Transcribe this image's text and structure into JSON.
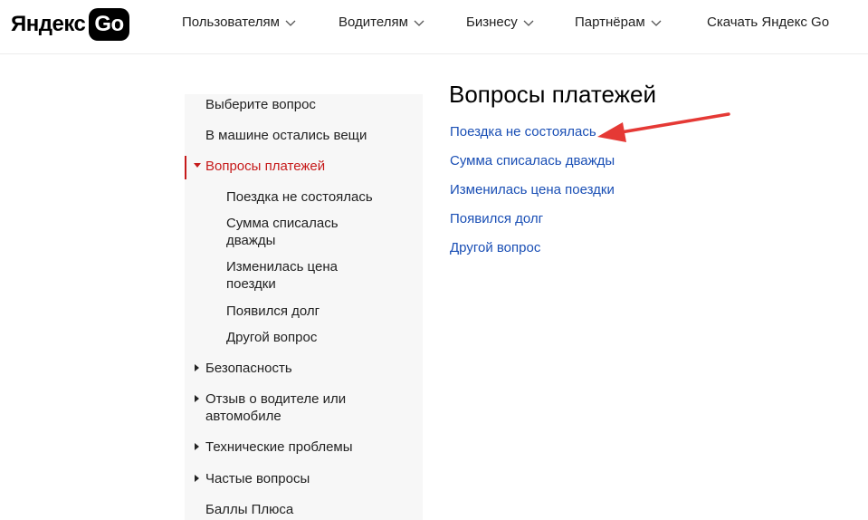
{
  "header": {
    "logo_text": "Яндекс",
    "logo_badge": "Go",
    "nav": [
      {
        "label": "Пользователям",
        "has_dropdown": true
      },
      {
        "label": "Водителям",
        "has_dropdown": true
      },
      {
        "label": "Бизнесу",
        "has_dropdown": true
      },
      {
        "label": "Партнёрам",
        "has_dropdown": true
      },
      {
        "label": "Скачать Яндекс Go",
        "has_dropdown": false
      }
    ]
  },
  "sidebar": {
    "items": [
      {
        "label": "Выберите вопрос"
      },
      {
        "label": "В машине остались вещи"
      },
      {
        "label": "Вопросы платежей",
        "expanded": true,
        "active": true
      },
      {
        "label": "Поездка не состоялась",
        "sub": true
      },
      {
        "label": "Сумма списалась дважды",
        "sub": true
      },
      {
        "label": "Изменилась цена поездки",
        "sub": true
      },
      {
        "label": "Появился долг",
        "sub": true
      },
      {
        "label": "Другой вопрос",
        "sub": true
      },
      {
        "label": "Безопасность",
        "collapsed": true
      },
      {
        "label": "Отзыв о водителе или автомобиле",
        "collapsed": true
      },
      {
        "label": "Технические проблемы",
        "collapsed": true
      },
      {
        "label": "Частые вопросы",
        "collapsed": true
      },
      {
        "label": "Баллы Плюса"
      }
    ]
  },
  "main": {
    "title": "Вопросы платежей",
    "links": [
      {
        "label": "Поездка не состоялась"
      },
      {
        "label": "Сумма списалась дважды"
      },
      {
        "label": "Изменилась цена поездки"
      },
      {
        "label": "Появился долг"
      },
      {
        "label": "Другой вопрос"
      }
    ]
  },
  "colors": {
    "accent_red": "#c61a1a",
    "link_blue": "#1a4fb5",
    "sidebar_bg": "#f7f7f7",
    "arrow_red": "#e53935"
  },
  "icons": {
    "nav_dropdown": "chevron-down-icon",
    "sidebar_collapsed": "triangle-right-icon",
    "sidebar_expanded": "triangle-down-icon",
    "annotation": "red-arrow-annotation"
  }
}
